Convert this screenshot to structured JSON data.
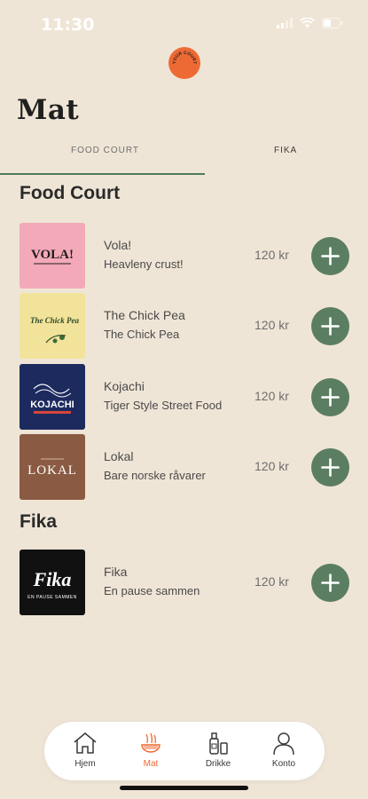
{
  "status": {
    "time": "11:30"
  },
  "logo": {
    "text": "YOUR COURT"
  },
  "page": {
    "title": "Mat"
  },
  "tabs": [
    {
      "label": "FOOD COURT",
      "active": true
    },
    {
      "label": "FIKA",
      "active": false
    }
  ],
  "sections": [
    {
      "title": "Food Court",
      "items": [
        {
          "name": "Vola!",
          "desc": "Heavleny crust!",
          "price": "120 kr",
          "logo_text": "VOLA!"
        },
        {
          "name": "The Chick Pea",
          "desc": "The Chick Pea",
          "price": "120 kr",
          "logo_text": "The Chick Pea"
        },
        {
          "name": "Kojachi",
          "desc": "Tiger Style Street Food",
          "price": "120 kr",
          "logo_text": "KOJACHI"
        },
        {
          "name": "Lokal",
          "desc": "Bare norske råvarer",
          "price": "120 kr",
          "logo_text": "LOKAL"
        }
      ]
    },
    {
      "title": "Fika",
      "items": [
        {
          "name": "Fika",
          "desc": "En pause sammen",
          "price": "120 kr",
          "logo_text": "Fika",
          "logo_subtext": "EN PAUSE SAMMEN"
        }
      ]
    }
  ],
  "nav": [
    {
      "label": "Hjem",
      "icon": "home-icon",
      "active": false
    },
    {
      "label": "Mat",
      "icon": "food-icon",
      "active": true
    },
    {
      "label": "Drikke",
      "icon": "drink-icon",
      "active": false
    },
    {
      "label": "Konto",
      "icon": "user-icon",
      "active": false
    }
  ],
  "colors": {
    "background": "#efe5d6",
    "accent": "#ee6a34",
    "green": "#5b7e62"
  }
}
